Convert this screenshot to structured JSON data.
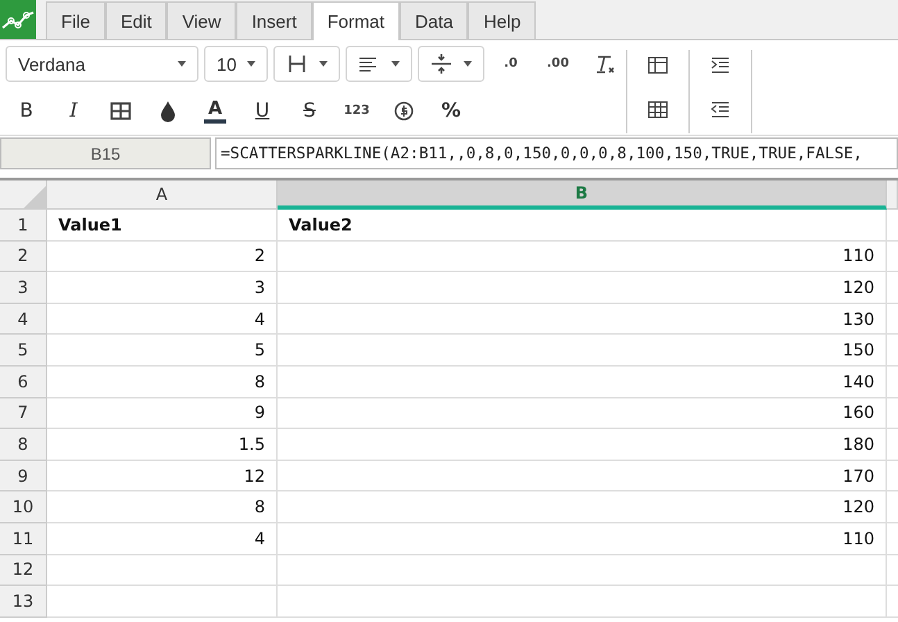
{
  "menu": [
    {
      "label": "File",
      "selected": false
    },
    {
      "label": "Edit",
      "selected": false
    },
    {
      "label": "View",
      "selected": false
    },
    {
      "label": "Insert",
      "selected": false
    },
    {
      "label": "Format",
      "selected": true
    },
    {
      "label": "Data",
      "selected": false
    },
    {
      "label": "Help",
      "selected": false
    }
  ],
  "toolbar": {
    "font": "Verdana",
    "size": "10",
    "bold": "B",
    "italic": "I",
    "font_color": "A",
    "underline": "U",
    "strike": "S",
    "number_format": "123",
    "percent": "%",
    "decrease_decimals": ".0",
    "increase_decimals": ".00"
  },
  "name_box": "B15",
  "formula": "=SCATTERSPARKLINE(A2:B11,,0,8,0,150,0,0,0,8,100,150,TRUE,TRUE,FALSE,",
  "columns": [
    {
      "label": "A",
      "selected": false
    },
    {
      "label": "B",
      "selected": true
    }
  ],
  "rows": [
    {
      "number": "1",
      "cells": [
        "Value1",
        "Value2"
      ],
      "kind": "header"
    },
    {
      "number": "2",
      "cells": [
        "2",
        "110"
      ],
      "kind": "number"
    },
    {
      "number": "3",
      "cells": [
        "3",
        "120"
      ],
      "kind": "number"
    },
    {
      "number": "4",
      "cells": [
        "4",
        "130"
      ],
      "kind": "number"
    },
    {
      "number": "5",
      "cells": [
        "5",
        "150"
      ],
      "kind": "number"
    },
    {
      "number": "6",
      "cells": [
        "8",
        "140"
      ],
      "kind": "number"
    },
    {
      "number": "7",
      "cells": [
        "9",
        "160"
      ],
      "kind": "number"
    },
    {
      "number": "8",
      "cells": [
        "1.5",
        "180"
      ],
      "kind": "number"
    },
    {
      "number": "9",
      "cells": [
        "12",
        "170"
      ],
      "kind": "number"
    },
    {
      "number": "10",
      "cells": [
        "8",
        "120"
      ],
      "kind": "number"
    },
    {
      "number": "11",
      "cells": [
        "4",
        "110"
      ],
      "kind": "number"
    },
    {
      "number": "12",
      "cells": [
        "",
        ""
      ],
      "kind": "empty"
    },
    {
      "number": "13",
      "cells": [
        "",
        ""
      ],
      "kind": "empty"
    }
  ]
}
